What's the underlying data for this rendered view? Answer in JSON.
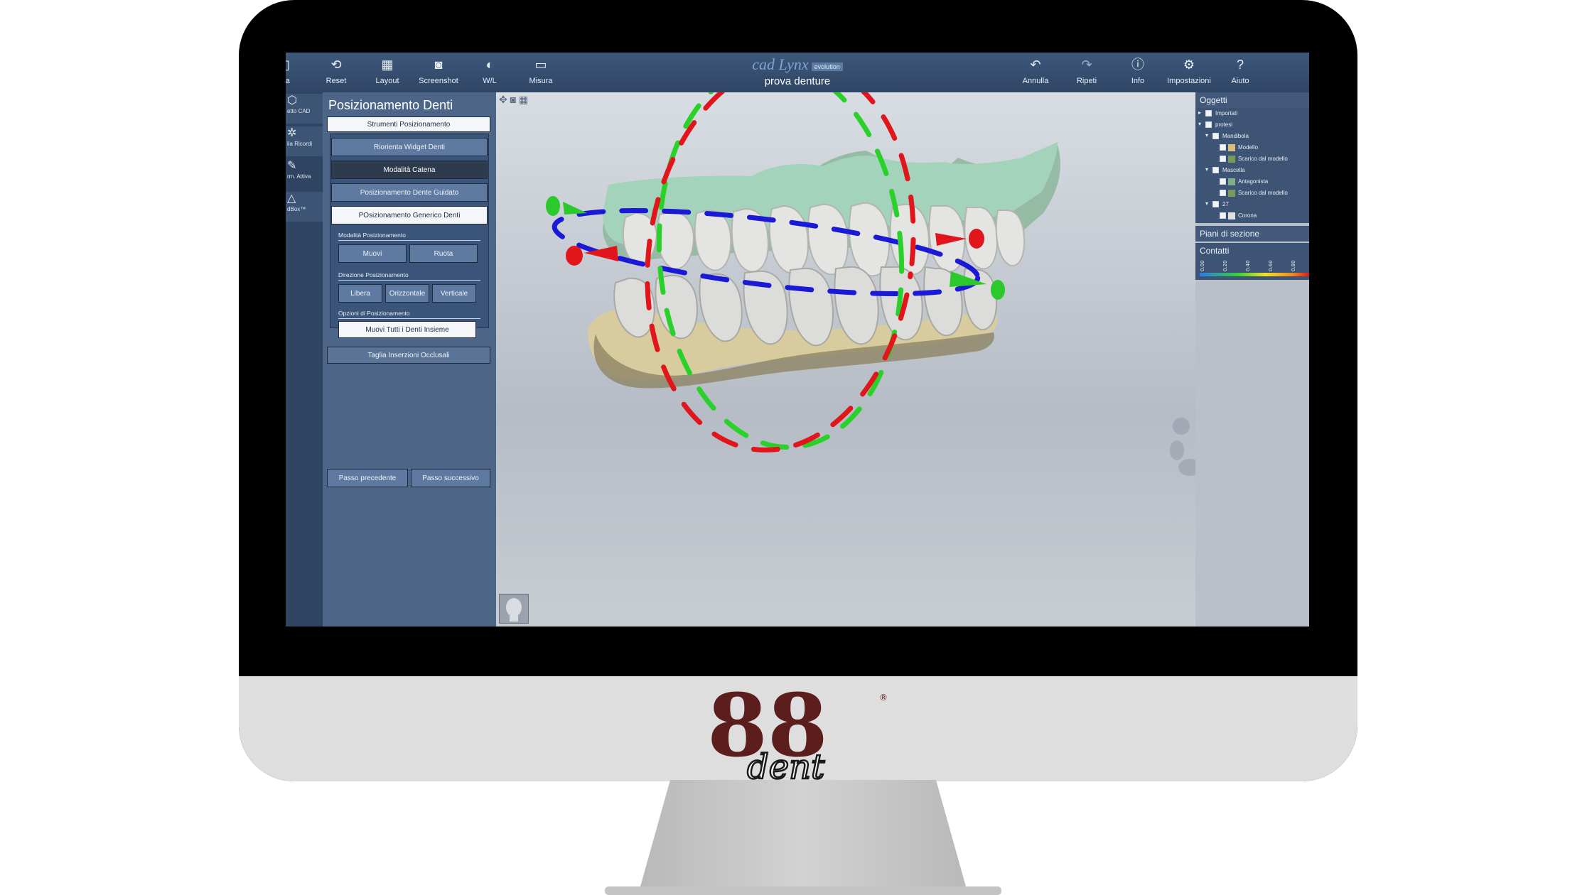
{
  "toolbar": {
    "left_buttons": [
      {
        "label": "ra",
        "icon": "folder-icon"
      },
      {
        "label": "Reset",
        "icon": "reset-icon"
      },
      {
        "label": "Layout",
        "icon": "layout-icon"
      },
      {
        "label": "Screenshot",
        "icon": "camera-icon"
      },
      {
        "label": "W/L",
        "icon": "contrast-icon"
      },
      {
        "label": "Misura",
        "icon": "ruler-icon"
      }
    ],
    "right_buttons": [
      {
        "label": "Annulla",
        "icon": "undo-icon"
      },
      {
        "label": "Ripeti",
        "icon": "redo-icon"
      },
      {
        "label": "Info",
        "icon": "info-icon"
      },
      {
        "label": "Impostazioni",
        "icon": "gear-icon"
      },
      {
        "label": "Aiuto",
        "icon": "help-icon"
      }
    ],
    "brand": "cad Lynx",
    "brand_sub": "evolution",
    "project": "prova denture"
  },
  "strip": {
    "items": [
      {
        "label": "etto CAD"
      },
      {
        "label": "lia Ricordi"
      },
      {
        "label": "rm. Attiva"
      },
      {
        "label": "dBox™"
      }
    ]
  },
  "panel": {
    "title": "Posizionamento Denti",
    "tools_header": "Strumenti Posizionamento",
    "btn_orienta": "Riorienta Widget Denti",
    "btn_catena": "Modalità Catena",
    "btn_guidato": "Posizionamento Dente Guidato",
    "btn_generico": "POsizionamento Generico Denti",
    "label_modalita": "Modalità Posizionamento",
    "btn_muovi": "Muovi",
    "btn_ruota": "Ruota",
    "label_direzione": "Direzione Posizionamento",
    "btn_libera": "Libera",
    "btn_orizzontale": "Orizzontale",
    "btn_verticale": "Verticale",
    "label_opzioni": "Opzioni di Posizionamento",
    "btn_muovi_tutti": "Muovi Tutti i Denti Insieme",
    "btn_taglia": "Taglia Inserzioni Occlusali",
    "btn_prev": "Passo precedente",
    "btn_next": "Passo successivo"
  },
  "right": {
    "objects_header": "Oggetti",
    "tree": [
      {
        "label": "Importati",
        "level": 0,
        "expanded": false
      },
      {
        "label": "protesi",
        "level": 0,
        "expanded": true
      },
      {
        "label": "Mandibola",
        "level": 1,
        "expanded": true
      },
      {
        "label": "Modello",
        "level": 2,
        "swatch": "#d9c07a"
      },
      {
        "label": "Scarico dal modello",
        "level": 2,
        "swatch": "#7a9a5a"
      },
      {
        "label": "Mascella",
        "level": 1,
        "expanded": true
      },
      {
        "label": "Antagonista",
        "level": 2,
        "swatch": "#7fae8e"
      },
      {
        "label": "Scarico dal modello",
        "level": 2,
        "swatch": "#7a9a5a"
      },
      {
        "label": "27",
        "level": 1,
        "expanded": true
      },
      {
        "label": "Corona",
        "level": 2,
        "swatch": "#e0e0e0"
      }
    ],
    "section_header": "Piani di sezione",
    "contacts_header": "Contatti",
    "contact_ticks": [
      "0.00",
      "0.20",
      "0.40",
      "0.60",
      "0.80"
    ]
  },
  "colors": {
    "upper_gum": "#9dc9b0",
    "lower_gum": "#d6c99a",
    "ring_red": "#e0161c",
    "ring_green": "#2bd12b",
    "ring_blue": "#1a1ad6"
  },
  "logo": {
    "number": "88",
    "word": "dent",
    "mark": "®"
  }
}
